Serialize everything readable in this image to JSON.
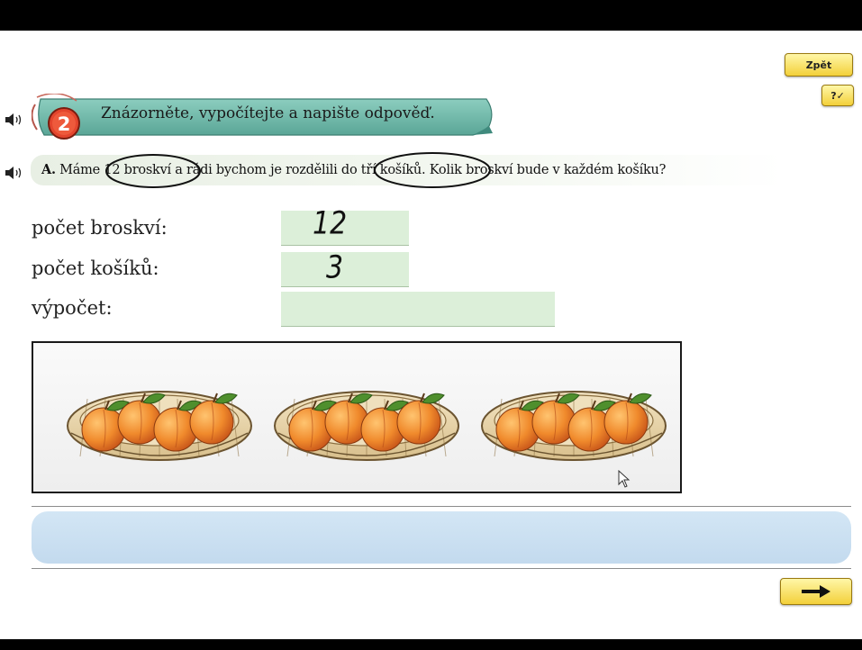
{
  "buttons": {
    "back_label": "Zpět",
    "help_label": "?✓",
    "next_icon": "right-arrow-icon"
  },
  "task": {
    "number": "2",
    "title": "Znázorněte, vypočítejte a napište odpověď."
  },
  "question": {
    "letter": "A.",
    "text": "Máme 12 broskví a rádi bychom je rozdělili do tří košíků. Kolik broskví bude v každém košíku?"
  },
  "form": {
    "peaches_label": "počet broskví:",
    "peaches_value": "12",
    "baskets_label": "počet košíků:",
    "baskets_value": "3",
    "calc_label": "výpočet:",
    "calc_value": ""
  },
  "picture": {
    "baskets": [
      {
        "peaches": 4
      },
      {
        "peaches": 4
      },
      {
        "peaches": 4
      }
    ]
  },
  "answer": {
    "text": ""
  },
  "colors": {
    "banner": "#6db6a8",
    "field": "#dcefd9",
    "answer_bar": "#c9dff1",
    "button": "#f3d03a",
    "peach": "#f08a2c"
  }
}
